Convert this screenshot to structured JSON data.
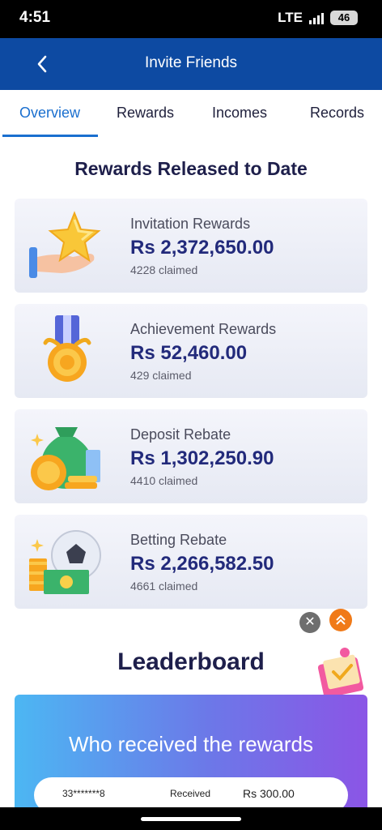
{
  "status_bar": {
    "time": "4:51",
    "network": "LTE",
    "battery": "46"
  },
  "header": {
    "title": "Invite Friends"
  },
  "tabs": [
    {
      "label": "Overview",
      "active": true
    },
    {
      "label": "Rewards",
      "active": false
    },
    {
      "label": "Incomes",
      "active": false
    },
    {
      "label": "Records",
      "active": false
    }
  ],
  "rewards_section": {
    "title": "Rewards Released to Date",
    "cards": [
      {
        "title": "Invitation Rewards",
        "amount": "Rs 2,372,650.00",
        "claimed": "4228 claimed",
        "icon": "star-hand-icon"
      },
      {
        "title": "Achievement Rewards",
        "amount": "Rs 52,460.00",
        "claimed": "429 claimed",
        "icon": "medal-icon"
      },
      {
        "title": "Deposit Rebate",
        "amount": "Rs 1,302,250.90",
        "claimed": "4410 claimed",
        "icon": "money-bag-icon"
      },
      {
        "title": "Betting Rebate",
        "amount": "Rs 2,266,582.50",
        "claimed": "4661 claimed",
        "icon": "soccer-money-icon"
      }
    ]
  },
  "leaderboard": {
    "title": "Leaderboard",
    "banner_title": "Who received the rewards",
    "rows": [
      {
        "user": "33*******8",
        "label": "Received",
        "amount": "Rs 300.00"
      }
    ]
  },
  "floating": {
    "close_symbol": "✕"
  },
  "colors": {
    "header_blue": "#0d4aa2",
    "tab_active": "#1a6fcf",
    "amount": "#222a7b",
    "orange": "#f07a18"
  }
}
